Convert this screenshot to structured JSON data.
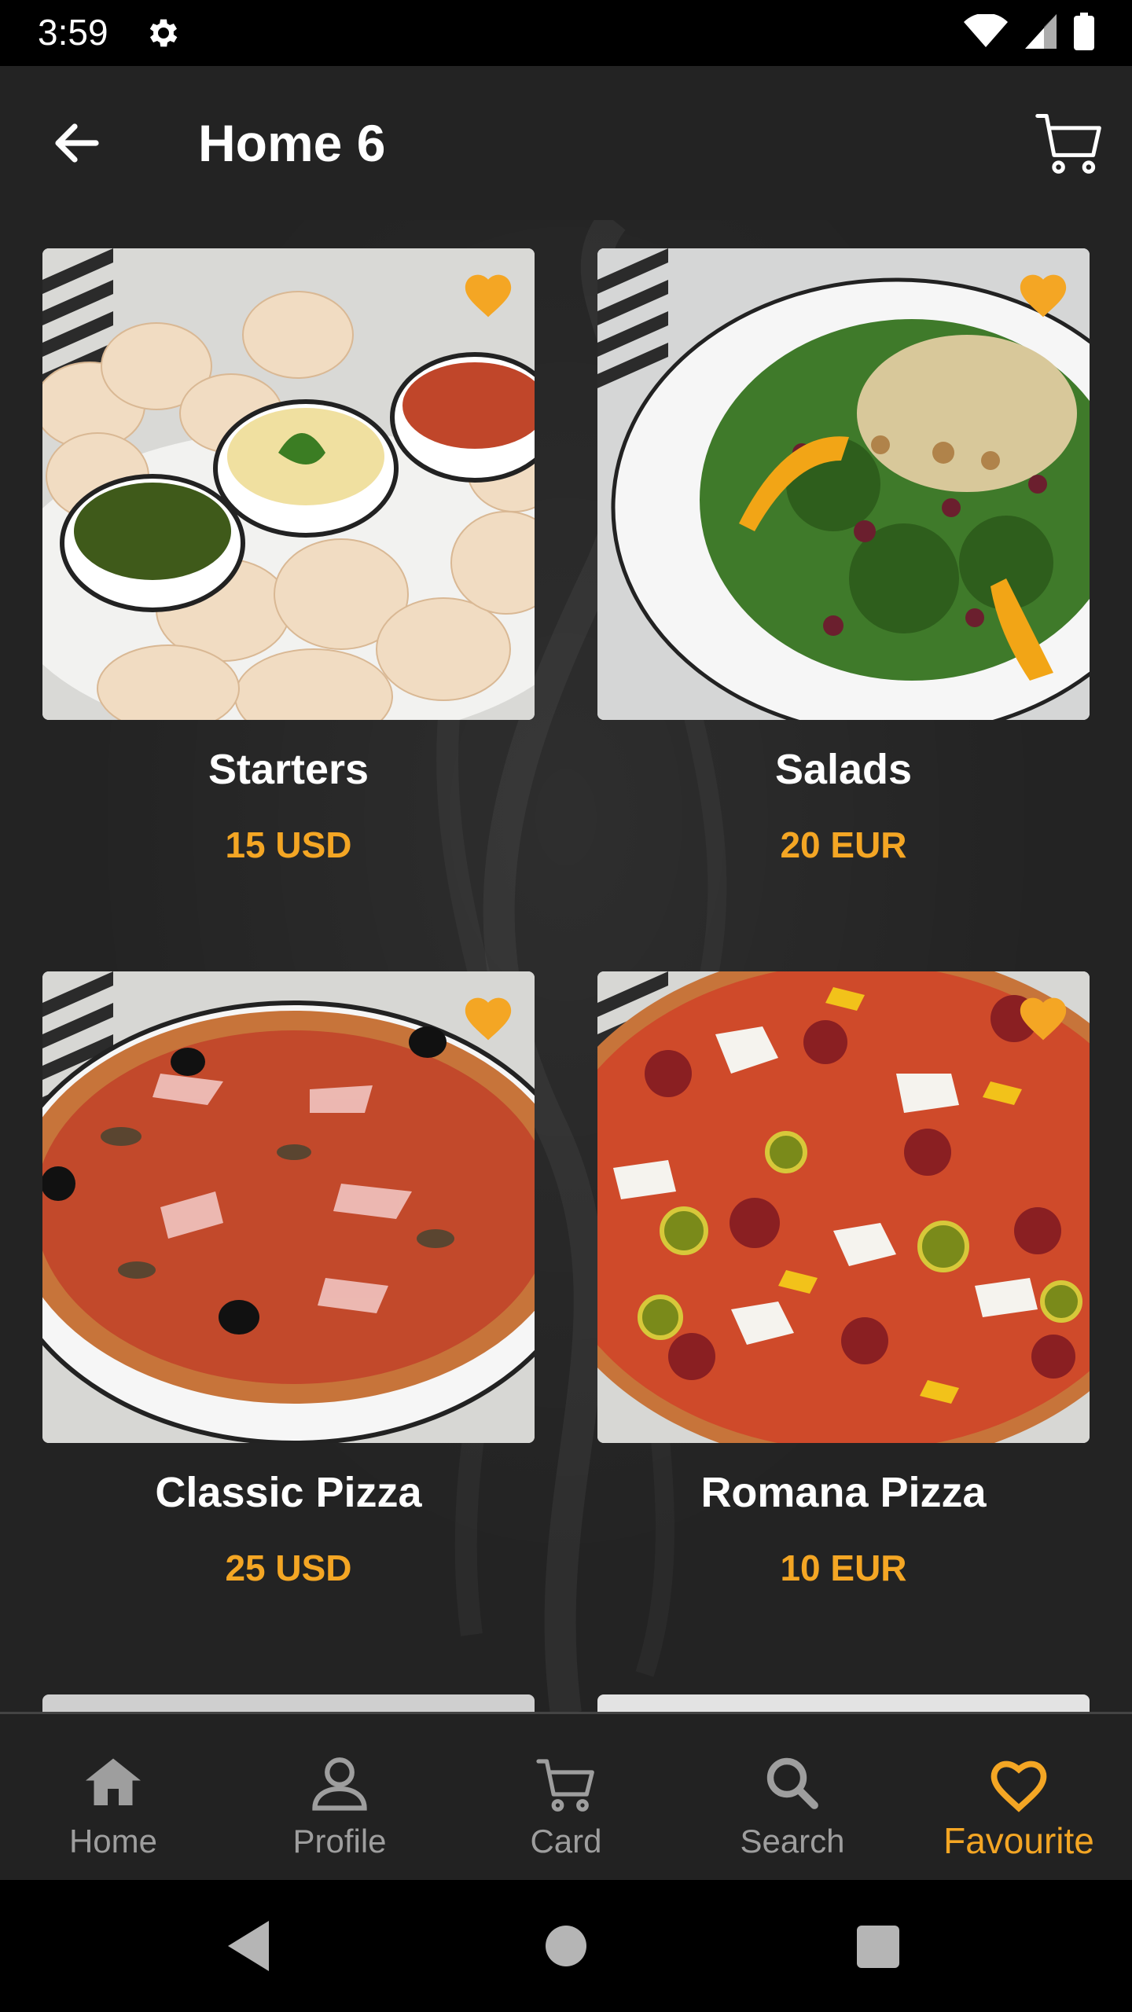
{
  "status_bar": {
    "time": "3:59"
  },
  "app_bar": {
    "title": "Home 6"
  },
  "items": [
    {
      "name": "Starters",
      "price": "15 USD"
    },
    {
      "name": "Salads",
      "price": "20 EUR"
    },
    {
      "name": "Classic Pizza",
      "price": "25 USD"
    },
    {
      "name": "Romana Pizza",
      "price": "10 EUR"
    }
  ],
  "bottom_nav": [
    {
      "label": "Home",
      "icon": "home-icon"
    },
    {
      "label": "Profile",
      "icon": "profile-icon"
    },
    {
      "label": "Card",
      "icon": "cart-icon"
    },
    {
      "label": "Search",
      "icon": "search-icon"
    },
    {
      "label": "Favourite",
      "icon": "heart-icon",
      "active": true
    }
  ],
  "colors": {
    "accent": "#f4a624",
    "background": "#232323",
    "inactive": "#9e9e9e"
  }
}
